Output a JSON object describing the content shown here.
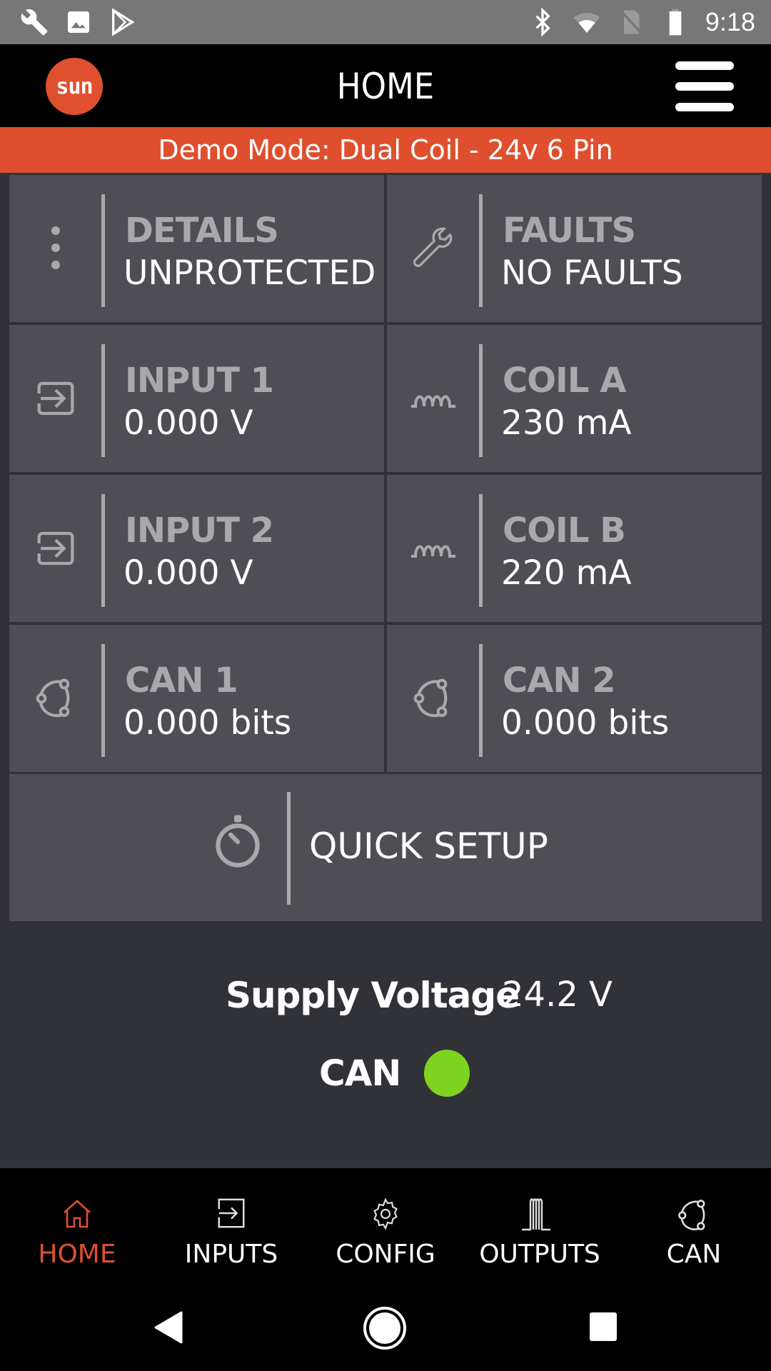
{
  "status_bar": {
    "time": "9:18",
    "left_icons": [
      "wrench-icon",
      "image-icon",
      "play-store-icon"
    ],
    "right_icons": [
      "bluetooth-icon",
      "wifi-icon",
      "no-sim-icon",
      "battery-icon"
    ]
  },
  "app_bar": {
    "logo_text": "sun",
    "title": "HOME",
    "menu_icon": "hamburger-menu-icon"
  },
  "banner": {
    "text": "Demo Mode: Dual Coil - 24v 6 Pin",
    "color": "#df4f2d"
  },
  "tiles": [
    {
      "label": "DETAILS",
      "value": "UNPROTECTED",
      "icon": "more-vertical-icon"
    },
    {
      "label": "FAULTS",
      "value": "NO FAULTS",
      "icon": "wrench-icon"
    },
    {
      "label": "INPUT 1",
      "value": "0.000 V",
      "icon": "input-icon"
    },
    {
      "label": "COIL A",
      "value": "230 mA",
      "icon": "coil-icon"
    },
    {
      "label": "INPUT 2",
      "value": "0.000 V",
      "icon": "input-icon"
    },
    {
      "label": "COIL B",
      "value": "220 mA",
      "icon": "coil-icon"
    },
    {
      "label": "CAN 1",
      "value": "0.000 bits",
      "icon": "can-network-icon"
    },
    {
      "label": "CAN 2",
      "value": "0.000 bits",
      "icon": "can-network-icon"
    }
  ],
  "quick_setup": {
    "label": "QUICK SETUP",
    "icon": "stopwatch-icon"
  },
  "supply": {
    "label": "Supply Voltage",
    "value": "24.2 V"
  },
  "can_status": {
    "label": "CAN",
    "state_color": "#7ed321"
  },
  "bottom_nav": {
    "items": [
      {
        "label": "HOME",
        "icon": "home-icon",
        "active": true
      },
      {
        "label": "INPUTS",
        "icon": "input-icon",
        "active": false
      },
      {
        "label": "CONFIG",
        "icon": "gear-icon",
        "active": false
      },
      {
        "label": "OUTPUTS",
        "icon": "outputs-icon",
        "active": false
      },
      {
        "label": "CAN",
        "icon": "can-network-icon",
        "active": false
      }
    ],
    "active_color": "#e0502e"
  }
}
